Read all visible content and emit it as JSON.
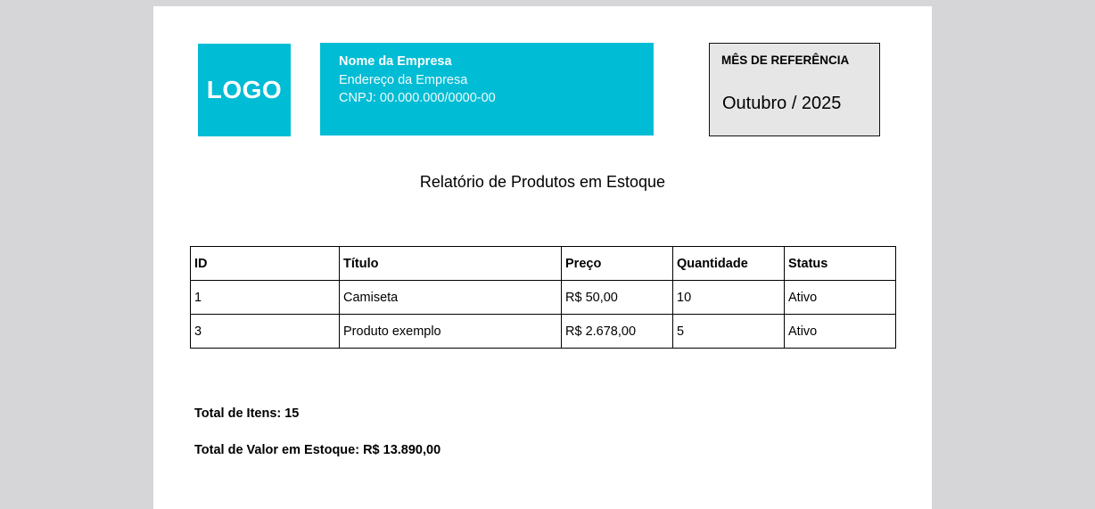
{
  "logo": {
    "text": "LOGO"
  },
  "company": {
    "name": "Nome da Empresa",
    "address": "Endereço da Empresa",
    "cnpj": "CNPJ: 00.000.000/0000-00"
  },
  "reference": {
    "label": "MÊS DE REFERÊNCIA",
    "value": "Outubro / 2025"
  },
  "report": {
    "title": "Relatório de Produtos em Estoque"
  },
  "table": {
    "headers": [
      "ID",
      "Título",
      "Preço",
      "Quantidade",
      "Status"
    ],
    "rows": [
      [
        "1",
        "Camiseta",
        "R$ 50,00",
        "10",
        "Ativo"
      ],
      [
        "3",
        "Produto exemplo",
        "R$ 2.678,00",
        "5",
        "Ativo"
      ]
    ]
  },
  "totals": {
    "items": "Total de Itens: 15",
    "value": "Total de Valor em Estoque: R$ 13.890,00"
  },
  "colors": {
    "brand": "#00bcd4",
    "reference_box": "#e6e6e6",
    "background": "#d6d6d8"
  }
}
